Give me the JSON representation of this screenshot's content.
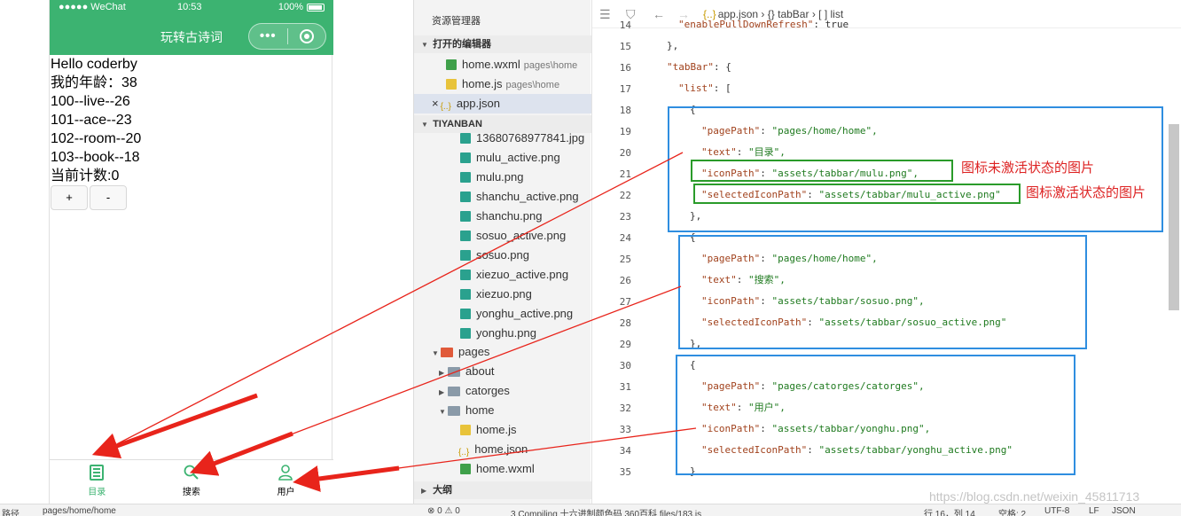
{
  "simulator": {
    "status": {
      "carrier": "●●●●● WeChat",
      "time": "10:53",
      "battery": "100%"
    },
    "nav_title": "玩转古诗词",
    "capsule_dots": "•••",
    "lines": [
      "Hello coderby",
      "我的年龄：38",
      "100--live--26",
      "101--ace--23",
      "102--room--20",
      "103--book--18",
      "当前计数:0"
    ],
    "buttons": {
      "plus": "+",
      "minus": "-"
    },
    "tabbar": [
      {
        "label": "目录",
        "icon": "list-icon",
        "active": true
      },
      {
        "label": "搜索",
        "icon": "search-icon",
        "active": false
      },
      {
        "label": "用户",
        "icon": "user-icon",
        "active": false
      }
    ],
    "accent": "#3cb371"
  },
  "explorer": {
    "title": "资源管理器",
    "open_editors_label": "打开的编辑器",
    "project_label": "TIYANBAN",
    "outline_label": "大纲",
    "open_editors": [
      {
        "name": "home.wxml",
        "path": "pages\\home",
        "type": "wxml"
      },
      {
        "name": "home.js",
        "path": "pages\\home",
        "type": "js"
      },
      {
        "name": "app.json",
        "path": "",
        "type": "json",
        "close": "×"
      }
    ],
    "files": [
      "13680768977841.jpg",
      "mulu_active.png",
      "mulu.png",
      "shanchu_active.png",
      "shanchu.png",
      "sosuo_active.png",
      "sosuo.png",
      "xiezuo_active.png",
      "xiezuo.png",
      "yonghu_active.png",
      "yonghu.png"
    ],
    "pages_folder": "pages",
    "subfolders": [
      "about",
      "catorges",
      "home"
    ],
    "home_files": [
      "home.js",
      "home.json",
      "home.wxml"
    ]
  },
  "editor": {
    "breadcrumb": {
      "file": "app.json",
      "node1": "tabBar",
      "node2": "list"
    },
    "line_numbers": [
      "14",
      "15",
      "16",
      "17",
      "18",
      "19",
      "20",
      "21",
      "22",
      "23",
      "24",
      "25",
      "26",
      "27",
      "28",
      "29",
      "30",
      "31",
      "32",
      "33",
      "34",
      "35"
    ],
    "lines": [
      {
        "text": "\"enablePullDownRefresh\": true",
        "indent": 1
      },
      {
        "text": "},",
        "indent": 0
      },
      {
        "text": "\"tabBar\": {",
        "indent": 0
      },
      {
        "text": "\"list\": [",
        "indent": 1
      },
      {
        "text": "{",
        "indent": 2
      },
      {
        "text": "\"pagePath\": \"pages/home/home\",",
        "indent": 3
      },
      {
        "text": "\"text\": \"目录\",",
        "indent": 3
      },
      {
        "text": "\"iconPath\": \"assets/tabbar/mulu.png\",",
        "indent": 3
      },
      {
        "text": "\"selectedIconPath\": \"assets/tabbar/mulu_active.png\"",
        "indent": 3
      },
      {
        "text": "},",
        "indent": 2
      },
      {
        "text": "{",
        "indent": 2
      },
      {
        "text": "\"pagePath\": \"pages/home/home\",",
        "indent": 3
      },
      {
        "text": "\"text\": \"搜索\",",
        "indent": 3
      },
      {
        "text": "\"iconPath\": \"assets/tabbar/sosuo.png\",",
        "indent": 3
      },
      {
        "text": "\"selectedIconPath\": \"assets/tabbar/sosuo_active.png\"",
        "indent": 3
      },
      {
        "text": "},",
        "indent": 2
      },
      {
        "text": "{",
        "indent": 2
      },
      {
        "text": "\"pagePath\": \"pages/catorges/catorges\",",
        "indent": 3
      },
      {
        "text": "\"text\": \"用户\",",
        "indent": 3
      },
      {
        "text": "\"iconPath\": \"assets/tabbar/yonghu.png\",",
        "indent": 3
      },
      {
        "text": "\"selectedIconPath\": \"assets/tabbar/yonghu_active.png\"",
        "indent": 3
      },
      {
        "text": "}",
        "indent": 2
      }
    ],
    "annotation_inactive": "图标未激活状态的图片",
    "annotation_active": "图标激活状态的图片"
  },
  "statusbar": {
    "left_path": "路径",
    "page_path": "pages/home/home",
    "problems": "⊗ 0 ⚠ 0",
    "compile": "3 Compiling 十六进制颜色码 360百科 files/183.js",
    "cursor": "行 16，列 14",
    "spaces": "空格: 2",
    "encoding": "UTF-8",
    "eol": "LF",
    "language": "JSON"
  },
  "watermark": "https://blog.csdn.net/weixin_45811713"
}
